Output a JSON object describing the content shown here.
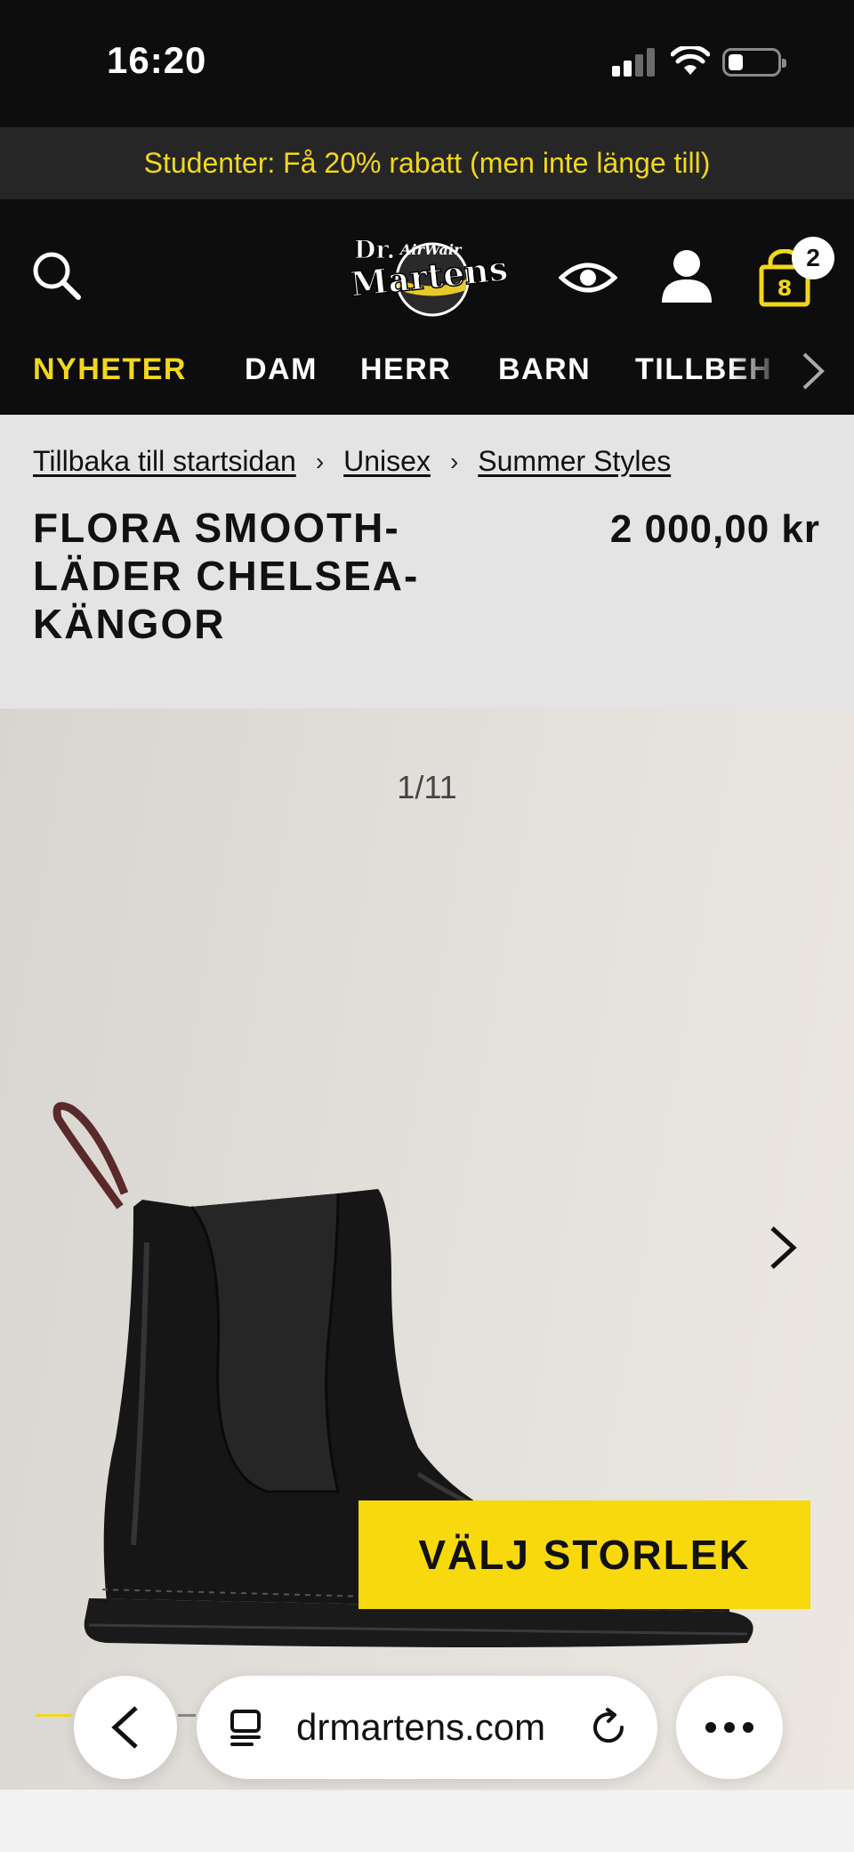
{
  "status_bar": {
    "time": "16:20"
  },
  "promo": {
    "text": "Studenter: Få 20% rabatt (men inte länge till)",
    "color": "#f2d71d"
  },
  "header": {
    "cart_count": "2",
    "icons": [
      "search-icon",
      "logo",
      "eye-icon",
      "account-icon",
      "cart-icon"
    ],
    "nav": [
      {
        "label": "NYHETER",
        "active": true
      },
      {
        "label": "DAM"
      },
      {
        "label": "HERR"
      },
      {
        "label": "BARN"
      },
      {
        "label": "TILLBEH"
      }
    ]
  },
  "breadcrumb": {
    "items": [
      "Tillbaka till startsidan",
      "Unisex",
      "Summer Styles"
    ],
    "separator": "›"
  },
  "product": {
    "title": "FLORA SMOOTH-LÄDER CHELSEA-KÄNGOR",
    "price": "2 000,00 kr"
  },
  "gallery": {
    "counter": "1/11",
    "cta_label": "VÄLJ STORLEK",
    "cta_color": "#f7d90e"
  },
  "browser": {
    "url": "drmartens.com"
  }
}
